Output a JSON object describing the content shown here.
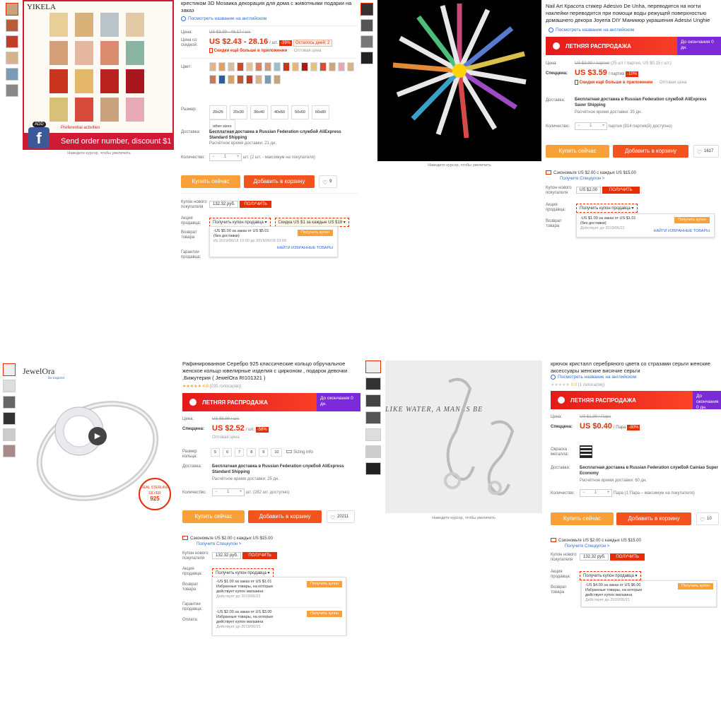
{
  "p1": {
    "brand": "YIKELA",
    "banner_text": "Send order number, discount $1",
    "add": "ADD",
    "preferential": "Preferential activities",
    "fb": "f",
    "hint": "Наведите курсор, чтобы увеличить",
    "title": "крестиком 3D Мозаика декорация для дома с животными подарки на заказ",
    "translate": "Посмотреть название на английском",
    "price_label": "Цена:",
    "old_price": "US $3.99 - 46.17 / шт.",
    "discount_price_label": "Цена со скидкой:",
    "price": "US $2.43 - 28.16",
    "unit": "/ шт.",
    "badge": "-39%",
    "days_left": "Осталось дней: 2",
    "app_discount": "Скидки ещё больше в приложении",
    "wholesale": "Оптовая цена",
    "color_label": "Цвет:",
    "size_label": "Размер:",
    "sizes": [
      "20x25",
      "20x30",
      "30x40",
      "40x50",
      "50x60",
      "60x80",
      "other sizes"
    ],
    "delivery_label": "Доставка:",
    "delivery": "Бесплатная доставка в Russian Federation службой AliExpress Standard Shipping",
    "delivery_time": "Расчётное время доставки: 21 дн.",
    "qty_label": "Количество:",
    "qty": "1",
    "qty_note": "шт. (2 шт. - максимум на покупателя)",
    "buy": "Купить сейчас",
    "cart": "Добавить в корзину",
    "wish_count": "9",
    "new_coupon_label": "Купон нового покупателя",
    "coupon_value": "132.32 руб.",
    "get": "ПОЛУЧИТЬ",
    "seller_promo_label": "Акция продавца:",
    "seller_coupon": "Получить купон продавца",
    "discount_promo": "Скидка US $1 за каждые US $19",
    "return_label": "Возврат товара",
    "guarantee_label": "Гарантии продавца:",
    "popup_line1": "-US $5.00 за заказ от US $5.01",
    "popup_line2": "(без доставки)",
    "popup_line3": "Из 2019/06/18 10:00 до 2019/06/18 23:59",
    "popup_btn": "Получить купон",
    "popup_link": "НАЙТИ ИЗБРАННЫЕ ТОВАРЫ"
  },
  "p2": {
    "hint": "Наведите курсор, чтобы увеличить",
    "title": "Nail Art Красота стикер Adesivo De Unha, переводятся на ногти наклейки переводятся при помощи воды режущей поверхностью домашнего декора Joyeria DIY Маникюр украшения Adesivi Unghie",
    "translate": "Посмотреть название на английском",
    "sale": "ЛЕТНЯЯ РАСПРОДАЖА",
    "sale_end": "До окончания 0 дн.",
    "price_label": "Цена:",
    "old_price": "US $3.99 / партия",
    "old_note": "(25 шт / партия, US $0.15 / шт.)",
    "special_label": "Спеццена:",
    "price": "US $3.59",
    "unit": "/ партия",
    "badge": "-10%",
    "app_discount": "Скидки ещё больше в приложении",
    "wholesale": "Оптовая цена",
    "delivery_label": "Доставка:",
    "delivery": "Бесплатная доставка в Russian Federation службой AliExpress Saver Shipping",
    "delivery_time": "Расчётное время доставки: 35 дн.",
    "qty_label": "Количество:",
    "qty": "1",
    "qty_note": "партия (914 партия(й) доступно)",
    "buy": "Купить сейчас",
    "cart": "Добавить в корзину",
    "wish_count": "1617",
    "save": "Сэкономьте US $2.00 с каждых US $15.00",
    "save_link": "Получите Спецкупон >",
    "new_coupon_label": "Купон нового покупателя",
    "coupon_value": "US $2.00",
    "get": "ПОЛУЧИТЬ",
    "seller_promo_label": "Акция продавца:",
    "seller_coupon": "Получить купон продавца",
    "return_label": "Возврат товара",
    "popup_line1": "-US $1.00 за заказ от US $1.01",
    "popup_line2": "(без доставки)",
    "popup_line3": "Действует до 2019/06/21",
    "popup_btn": "Получить купон",
    "popup_link": "НАЙТИ ИЗБРАННЫЕ ТОВАРЫ"
  },
  "p3": {
    "brand": "JewelOra",
    "brand_sub": "Be inspired",
    "stamp": "REAL STERLING SILVER",
    "stamp_num": "925",
    "title": "Рафинированное Серебро 925 классические кольцо обручальное женское кольцо ювелирные изделия с цирконом , подарок девочки ,Бижутерия ( JewelOra RI101321 )",
    "rating": "4.8",
    "reviews": "(235 голоса(ов))",
    "sale": "ЛЕТНЯЯ РАСПРОДАЖА",
    "sale_end": "До окончания 0 дн.",
    "price_label": "Цена:",
    "old_price": "US $5.99 / шт.",
    "special_label": "Спеццена:",
    "price": "US $2.52",
    "unit": "/ шт.",
    "badge": "-58%",
    "wholesale": "Оптовая цена",
    "size_label": "Размер кольца:",
    "sizes": [
      "5",
      "6",
      "7",
      "8",
      "9",
      "10"
    ],
    "size_info": "Sizing info",
    "delivery_label": "Доставка:",
    "delivery": "Бесплатная доставка в Russian Federation службой AliExpress Standard Shipping",
    "delivery_time": "Расчётное время доставки: 25 дн.",
    "qty_label": "Количество:",
    "qty": "1",
    "qty_note": "шт. (282 шт. доступно)",
    "buy": "Купить сейчас",
    "cart": "Добавить в корзину",
    "wish_count": "20211",
    "save": "Сэкономьте US $2.00 с каждых US $15.00",
    "save_link": "Получите Спецкупон >",
    "new_coupon_label": "Купон нового покупателя",
    "coupon_value": "132.32 руб.",
    "get": "ПОЛУЧИТЬ",
    "seller_promo_label": "Акция продавца:",
    "seller_coupon": "Получить купон продавца",
    "return_label": "Возврат товара",
    "guarantee_label": "Гарантии продавца:",
    "pay_label": "Оплата:",
    "popup_a1": "-US $1.00 за заказ от US $1.01",
    "popup_a2": "Избранные товары, на которые действует купон магазина",
    "popup_a3": "Действует до 2019/06/21",
    "popup_b1": "-US $2.00 за заказ от US $3.00",
    "popup_b2": "Избранные товары, на которые действует купон магазина",
    "popup_b3": "Действует до 2019/06/21",
    "popup_btn": "Получить купон"
  },
  "p4": {
    "hint": "Наведите курсор, чтобы увеличить",
    "image_text": "LIKE WATER, A MAN IS BE",
    "title": "крючок кристалл серебряного цвета со стразами серьги женские аксессуары женские висячие серьги",
    "translate": "Посмотреть название на английском",
    "rating": "0.0",
    "reviews": "(1 голоса(ов))",
    "sale": "ЛЕТНЯЯ РАСПРОДАЖА",
    "sale_end": "До окончания 0 дн.",
    "price_label": "Цена:",
    "old_price": "US $1.99 / Пара",
    "special_label": "Спеццена:",
    "price": "US $0.40",
    "unit": "/ Пара",
    "badge": "-80%",
    "metal_label": "Окраска металла:",
    "delivery_label": "Доставка:",
    "delivery": "Бесплатная доставка в Russian Federation службой Cainiao Super Economy",
    "delivery_time": "Расчётное время доставки: 60 дн.",
    "qty_label": "Количество:",
    "qty": "1",
    "qty_note": "Пара (1 Пара – максимум на покупателя)",
    "buy": "Купить сейчас",
    "cart": "Добавить в корзину",
    "wish_count": "10",
    "save": "Сэкономьте US $2.00 с каждых US $15.00",
    "save_link": "Получите Спецкупон >",
    "new_coupon_label": "Купон нового покупателя",
    "coupon_value": "132.32 руб.",
    "get": "ПОЛУЧИТЬ",
    "seller_promo_label": "Акция продавца:",
    "seller_coupon": "Получить купон продавца",
    "return_label": "Возврат товара",
    "popup_line1": "-US $4.00 за заказ от US $6.00",
    "popup_line2": "Избранные товары, на которые действует купон магазина",
    "popup_line3": "Действует до 2019/06/21",
    "popup_btn": "Получить купон"
  },
  "colors": {
    "accent": "#e62e04",
    "buy": "#f9a03a",
    "cart": "#f3541d",
    "sale_end": "#7a2ad6",
    "link": "#2f6dd6"
  }
}
